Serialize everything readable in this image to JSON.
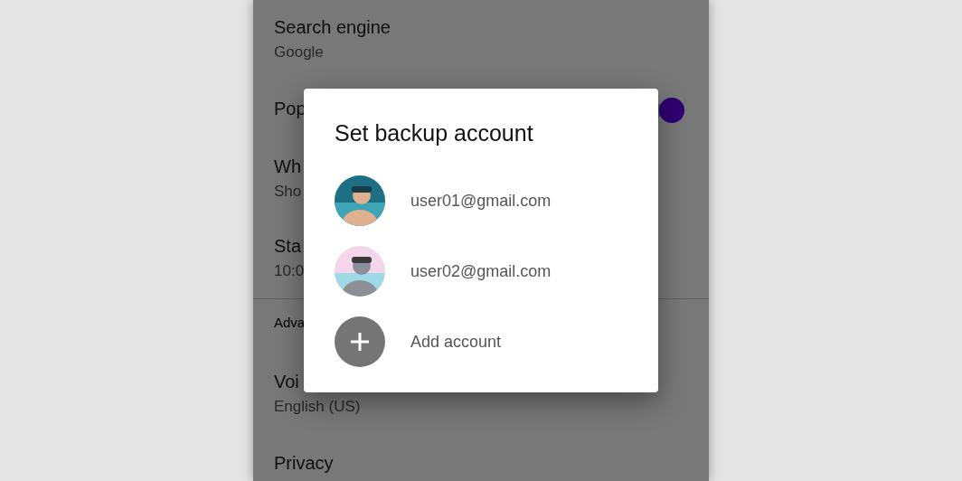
{
  "settings": [
    {
      "kind": "item",
      "title": "Search engine",
      "subtitle": "Google"
    },
    {
      "kind": "toggle",
      "title": "Pop",
      "on": true
    },
    {
      "kind": "item",
      "title": "Wh",
      "subtitle": "Sho"
    },
    {
      "kind": "item",
      "title": "Sta",
      "subtitle": "10:0"
    },
    {
      "kind": "header",
      "title": "Adva"
    },
    {
      "kind": "item",
      "title": "Voi",
      "subtitle": "English (US)"
    },
    {
      "kind": "item",
      "title": "Privacy"
    }
  ],
  "dialog": {
    "title": "Set backup account",
    "accounts": [
      {
        "kind": "account",
        "email": "user01@gmail.com"
      },
      {
        "kind": "account",
        "email": "user02@gmail.com"
      },
      {
        "kind": "add",
        "label": "Add account"
      }
    ]
  }
}
